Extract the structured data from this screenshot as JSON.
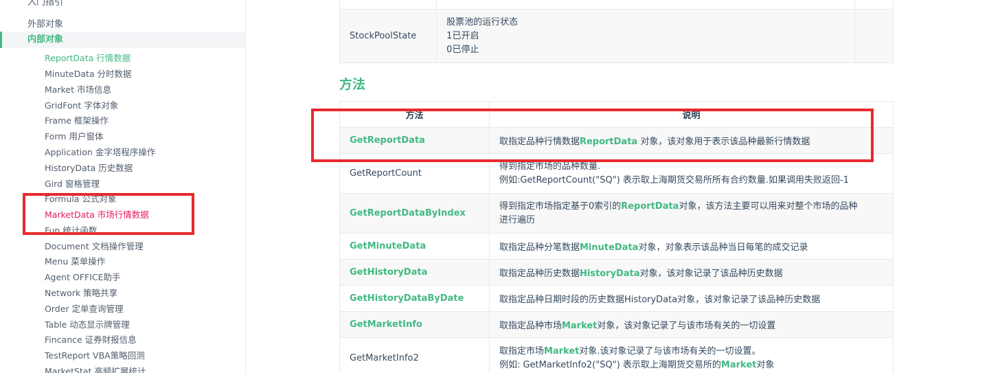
{
  "sidebar": {
    "top_items": [
      "入门指引",
      "外部对象",
      "内部对象"
    ],
    "sub_items": [
      "ReportData 行情数据",
      "MinuteData 分时数据",
      "Market 市场信息",
      "GridFont 字体对象",
      "Frame 框架操作",
      "Form 用户窗体",
      "Application 金字塔程序操作",
      "HistoryData 历史数据",
      "Gird 窗格管理",
      "Formula 公式对象",
      "MarketData 市场行情数据",
      "Fun 统计函数",
      "Document 文档操作管理",
      "Menu 菜单操作",
      "Agent OFFICE助手",
      "Network 策略共享",
      "Order 定单查询管理",
      "Table 动态显示牌管理",
      "Fincance 证券财报信息",
      "TestReport VBA策略回测",
      "MarketStat 高频扩展统计"
    ]
  },
  "props_table": {
    "row_prev": "",
    "name": "StockPoolState",
    "desc_lines": [
      "股票池的运行状态",
      "1已开启",
      "0已停止"
    ]
  },
  "section_title": "方法",
  "methods_table": {
    "headers": [
      "方法",
      "说明"
    ],
    "rows": [
      {
        "name": "GetReportData",
        "desc": "取指定品种行情数据ReportData 对象，该对象用于表示该品种最新行情数据"
      },
      {
        "name": "GetReportCount",
        "desc": "得到指定市场的品种数量.",
        "desc2": "例如:GetReportCount(\"SQ\") 表示取上海期货交易所所有合约数量.如果调用失败返回-1"
      },
      {
        "name": "GetReportDataByIndex",
        "desc": "得到指定市场指定基于0索引的ReportData对象，该方法主要可以用来对整个市场的品种",
        "desc2": "进行遍历"
      },
      {
        "name": "GetMinuteData",
        "desc": "取指定品种分笔数据MinuteData对象，对象表示该品种当日每笔的成交记录"
      },
      {
        "name": "GetHistoryData",
        "desc": "取指定品种历史数据HistoryData对象，该对象记录了该品种历史数据"
      },
      {
        "name": "GetHistoryDataByDate",
        "desc": "取指定品种日期时段的历史数据HistoryData对象，该对象记录了该品种历史数据"
      },
      {
        "name": "GetMarketInfo",
        "desc": "取指定品种市场Market对象，该对象记录了与该市场有关的一切设置"
      },
      {
        "name": "GetMarketInfo2",
        "desc": "取指定市场Market对象.该对象记录了与该市场有关的一切设置。",
        "desc2": "例如: GetMarketInfo2(\"SQ\") 表示取上海期货交易所的Market对象"
      }
    ]
  }
}
